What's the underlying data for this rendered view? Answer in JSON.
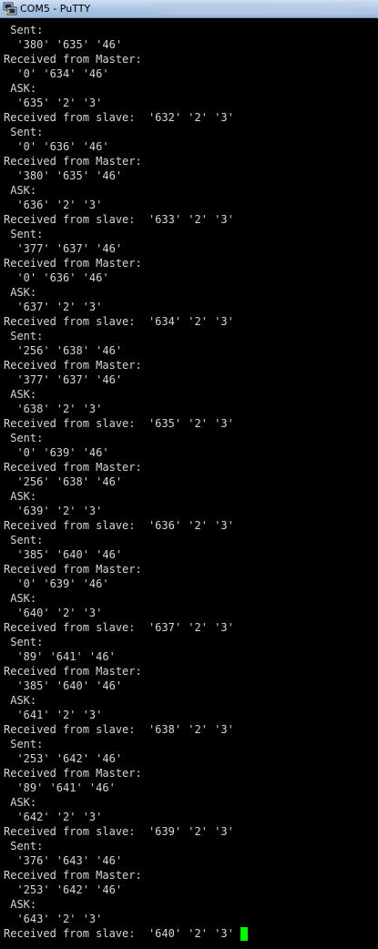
{
  "window": {
    "title": "COM5 - PuTTY",
    "icon": "putty-terminal-icon"
  },
  "colors": {
    "background": "#000000",
    "text": "#d6d6d6",
    "cursor": "#00ff00"
  },
  "terminal": {
    "lines": [
      " Sent:",
      "  '380' '635' '46'",
      "Received from Master:",
      "  '0' '634' '46'",
      " ASK:",
      "  '635' '2' '3'",
      "Received from slave:  '632' '2' '3'",
      " Sent:",
      "  '0' '636' '46'",
      "Received from Master:",
      "  '380' '635' '46'",
      " ASK:",
      "  '636' '2' '3'",
      "Received from slave:  '633' '2' '3'",
      " Sent:",
      "  '377' '637' '46'",
      "Received from Master:",
      "  '0' '636' '46'",
      " ASK:",
      "  '637' '2' '3'",
      "Received from slave:  '634' '2' '3'",
      " Sent:",
      "  '256' '638' '46'",
      "Received from Master:",
      "  '377' '637' '46'",
      " ASK:",
      "  '638' '2' '3'",
      "Received from slave:  '635' '2' '3'",
      " Sent:",
      "  '0' '639' '46'",
      "Received from Master:",
      "  '256' '638' '46'",
      " ASK:",
      "  '639' '2' '3'",
      "Received from slave:  '636' '2' '3'",
      " Sent:",
      "  '385' '640' '46'",
      "Received from Master:",
      "  '0' '639' '46'",
      " ASK:",
      "  '640' '2' '3'",
      "Received from slave:  '637' '2' '3'",
      " Sent:",
      "  '89' '641' '46'",
      "Received from Master:",
      "  '385' '640' '46'",
      " ASK:",
      "  '641' '2' '3'",
      "Received from slave:  '638' '2' '3'",
      " Sent:",
      "  '253' '642' '46'",
      "Received from Master:",
      "  '89' '641' '46'",
      " ASK:",
      "  '642' '2' '3'",
      "Received from slave:  '639' '2' '3'",
      " Sent:",
      "  '376' '643' '46'",
      "Received from Master:",
      "  '253' '642' '46'",
      " ASK:",
      "  '643' '2' '3'",
      "Received from slave:  '640' '2' '3'"
    ]
  }
}
